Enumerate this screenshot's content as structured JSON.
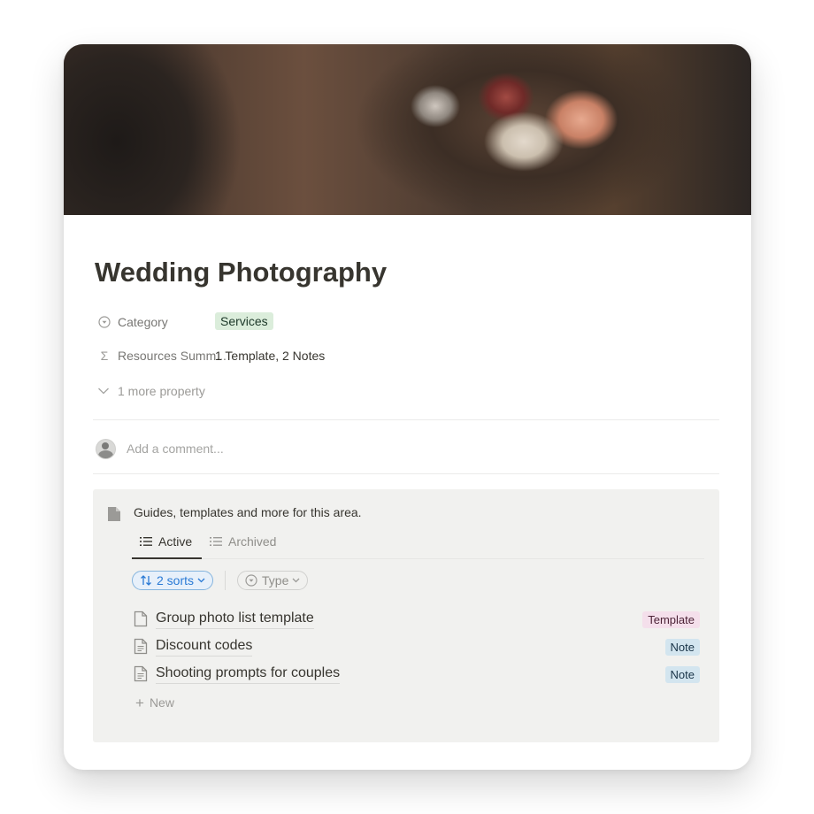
{
  "page": {
    "title": "Wedding Photography"
  },
  "properties": {
    "category": {
      "name": "Category",
      "value": "Services",
      "icon": "select-icon"
    },
    "resources_summary": {
      "name": "Resources Summ...",
      "value": "1 Template, 2 Notes",
      "icon": "sigma-icon"
    },
    "more": "1 more property"
  },
  "comment": {
    "placeholder": "Add a comment..."
  },
  "callout": {
    "icon": "document-icon",
    "text": "Guides, templates and more for this area.",
    "tabs": [
      {
        "label": "Active",
        "active": true
      },
      {
        "label": "Archived",
        "active": false
      }
    ],
    "filters": {
      "sorts_label": "2 sorts",
      "type_label": "Type"
    },
    "items": [
      {
        "title": "Group photo list template",
        "tag": "Template"
      },
      {
        "title": "Discount codes",
        "tag": "Note"
      },
      {
        "title": "Shooting prompts for couples",
        "tag": "Note"
      }
    ],
    "new_label": "New"
  },
  "colors": {
    "tag_services_bg": "#dbeddb",
    "tag_template_bg": "#f4dfeb",
    "tag_note_bg": "#d3e5ef",
    "accent_blue": "#2a7ad5"
  }
}
